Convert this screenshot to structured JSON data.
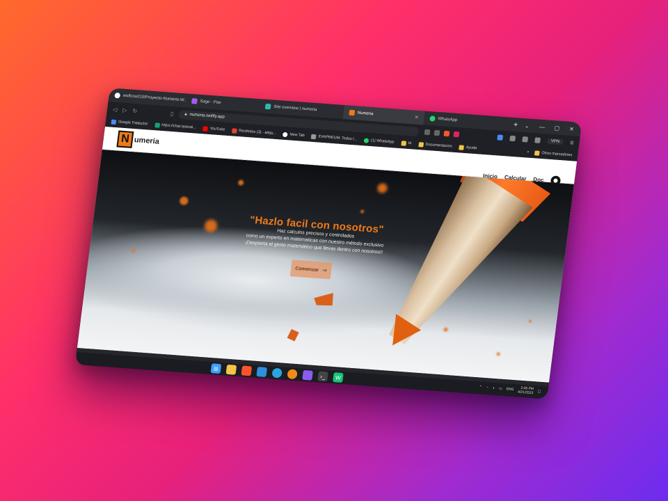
{
  "browser": {
    "tabs": [
      {
        "label": "wolfcou010/Proyecto-Numeria-W...",
        "icon": "github-icon",
        "color": "#ffffff",
        "active": false
      },
      {
        "label": "Sage - Poe",
        "icon": "poe-icon",
        "color": "#a05cf0",
        "active": false
      },
      {
        "label": "Site overview | numeria",
        "icon": "netlify-icon",
        "color": "#2fb6b0",
        "active": false
      },
      {
        "label": "Numeria",
        "icon": "numeria-icon",
        "color": "#ef7a1a",
        "active": true
      },
      {
        "label": "WhatsApp",
        "icon": "whatsapp-icon",
        "color": "#25d366",
        "active": false
      }
    ],
    "new_tab_label": "+",
    "url": "numeria.netlify.app",
    "vpn_label": "VPN",
    "bookmarks": [
      {
        "label": "Google Traductor",
        "icon": "translate-icon",
        "color": "#4a8af4"
      },
      {
        "label": "https://chat.openai...",
        "icon": "chatgpt-icon",
        "color": "#10a37f"
      },
      {
        "label": "YouTube",
        "icon": "youtube-icon",
        "color": "#ff0000"
      },
      {
        "label": "Recibidos (3) - aleja...",
        "icon": "gmail-icon",
        "color": "#ea4335"
      },
      {
        "label": "New Tab",
        "icon": "github-icon",
        "color": "#ffffff"
      },
      {
        "label": "EVAPREUM: Todos l...",
        "icon": "page-icon",
        "color": "#999999"
      },
      {
        "label": "(1) WhatsApp",
        "icon": "whatsapp-icon",
        "color": "#25d366"
      },
      {
        "label": "IA",
        "icon": "folder-icon",
        "color": "#f4c34a"
      },
      {
        "label": "Documentacion",
        "icon": "folder-icon",
        "color": "#f4c34a"
      },
      {
        "label": "Ayuda",
        "icon": "folder-icon",
        "color": "#f4c34a"
      }
    ],
    "other_bookmarks_label": "Otros marcadores"
  },
  "site": {
    "logo_letter": "N",
    "logo_text": "umeria",
    "nav": [
      "Inicio",
      "Calcular",
      "Doc"
    ],
    "hero_title": "\"Hazlo facil con nosotros\"",
    "hero_lines": [
      "Haz calculos precisos y controlados",
      "como un experto en matematicas con nuestro método exclusivo",
      "¡Despierta el genio matemático que llevas dentro con nosotros!!"
    ],
    "cta_label": "Comenzar",
    "cta_arrow": "⇨",
    "accent": "#ef7a1a"
  },
  "taskbar": {
    "apps": [
      {
        "name": "windows-start",
        "color": "#3aa0ff"
      },
      {
        "name": "file-explorer",
        "color": "#f4c34a"
      },
      {
        "name": "brave",
        "color": "#fb542b"
      },
      {
        "name": "vscode",
        "color": "#2d8fe0"
      },
      {
        "name": "telegram",
        "color": "#2aa5e0"
      },
      {
        "name": "search-app",
        "color": "#f08a1a"
      },
      {
        "name": "affinity",
        "color": "#8a5cf0"
      },
      {
        "name": "terminal",
        "color": "#444444"
      },
      {
        "name": "webstorm",
        "color": "#17c37a"
      }
    ],
    "language": "ENG",
    "time": "2:45 PM",
    "date": "4/21/2023"
  }
}
